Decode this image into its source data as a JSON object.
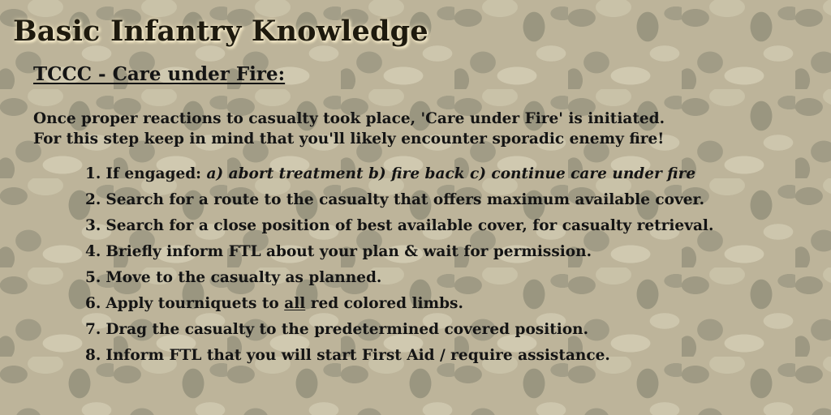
{
  "page": {
    "title": "Basic Infantry Knowledge",
    "subtitle": "TCCC - Care under Fire:",
    "intro": [
      "Once proper reactions to casualty took place, 'Care under Fire' is initiated.",
      "For this step keep in mind that you'll likely encounter sporadic enemy fire!"
    ]
  },
  "steps": [
    {
      "num": "1.",
      "text": "If engaged: ",
      "emphasis": "a) abort treatment b) fire back c) continue care under fire"
    },
    {
      "num": "2.",
      "text": "Search for a route to the casualty that offers maximum available cover."
    },
    {
      "num": "3.",
      "text": "Search for a close position of best available cover, for casualty retrieval."
    },
    {
      "num": "4.",
      "text": "Briefly inform FTL about your plan & wait for permission."
    },
    {
      "num": "5.",
      "text": "Move to the casualty as planned."
    },
    {
      "num": "6.",
      "before": "Apply tourniquets to ",
      "underlined": "all",
      "after": " red colored limbs."
    },
    {
      "num": "7.",
      "text": "Drag the casualty to the predetermined covered position."
    },
    {
      "num": "8.",
      "text": "Inform FTL that you will start First Aid / require assistance."
    }
  ]
}
